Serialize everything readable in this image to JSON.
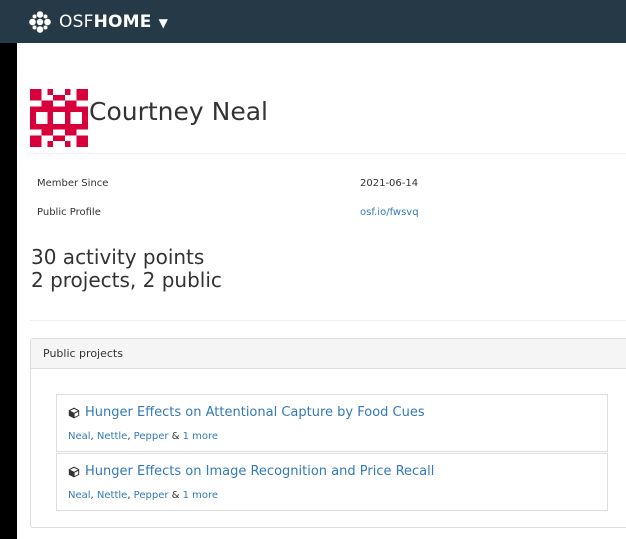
{
  "navbar": {
    "brand_osf": "OSF",
    "brand_home": "HOME",
    "caret": "▼"
  },
  "profile": {
    "name": "Courtney Neal",
    "member_since_label": "Member Since",
    "member_since_value": "2021-06-14",
    "public_profile_label": "Public Profile",
    "public_profile_value": "osf.io/fwsvq",
    "activity_points": "30 activity points",
    "projects_summary": "2 projects, 2 public"
  },
  "panel": {
    "heading": "Public projects",
    "projects": [
      {
        "title": "Hunger Effects on Attentional Capture by Food Cues",
        "c1": "Neal",
        "c2": "Nettle",
        "c3": "Pepper",
        "amp": " & ",
        "more": "1 more"
      },
      {
        "title": "Hunger Effects on Image Recognition and Price Recall",
        "c1": "Neal",
        "c2": "Nettle",
        "c3": "Pepper",
        "amp": " & ",
        "more": "1 more"
      }
    ]
  },
  "colors": {
    "navbar": "#263947",
    "link": "#337ab7",
    "identicon": "#d8003a"
  },
  "icons": [
    "osf-logo-icon",
    "chevron-down-icon",
    "user-identicon",
    "project-cube-icon"
  ]
}
